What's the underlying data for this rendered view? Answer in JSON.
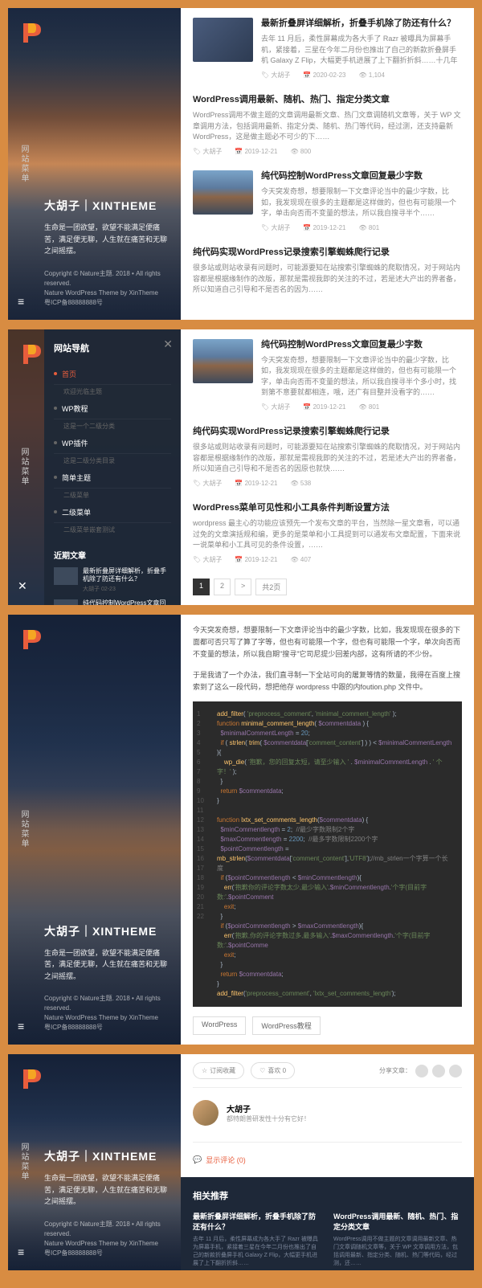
{
  "site": {
    "title": "大胡子｜XINTHEME",
    "desc": "生命是一团欲望，欲望不能满足便痛苦，满足便无聊，人生就在痛苦和无聊之间摇摆。",
    "copyright": "Copyright © Nature主题. 2018 • All rights reserved.",
    "theme": "Nature WordPress Theme by XinTheme",
    "icp": "粤ICP备88888888号"
  },
  "vmenu_label": "网站菜单",
  "nav": {
    "title": "网站导航",
    "items": [
      {
        "label": "首页",
        "sub": "欢迎光临主题",
        "active": true
      },
      {
        "label": "WP教程",
        "sub": "这是一个二级分类"
      },
      {
        "label": "WP插件",
        "sub": "这是二级分类目录"
      },
      {
        "label": "简单主题",
        "sub": "二级菜单"
      },
      {
        "label": "二级菜单",
        "sub": "二级菜单嵌套测试"
      }
    ],
    "recent_h": "近期文章",
    "recent": [
      {
        "t": "最新折叠屏详细解析，折叠手机除了防还有什么？",
        "m": "大胡子 02-23"
      },
      {
        "t": "纯代码控制WordPress文章回复最少字数",
        "m": ""
      }
    ]
  },
  "shot1": {
    "posts": [
      {
        "thumb": true,
        "title": "最新折叠屏详细解析，折叠手机除了防还有什么？",
        "excerpt": "去年 11 月后，柔性屏幕成为各大手了 Razr 被曝具为屏幕手机，紧接着，三星在今年二月份也推出了自己的新款折叠屏手机 Galaxy Z Flip，大幅更手机进展了上下翻折折斜……十几年",
        "meta": [
          "大胡子",
          "2020-02-23",
          "1,104"
        ]
      },
      {
        "thumb": false,
        "title": "WordPress调用最新、随机、热门、指定分类文章",
        "excerpt": "WordPress调用不做主题的文章调用最新文章、热门文章调随机文章等，关于 WP 文章调用方法，包括调用最新、指定分类、随机、热门等代码，经过测，还支持最新 WordPress，这是做主题必不可少的下……",
        "meta": [
          "大胡子",
          "2019-12-21",
          "800"
        ]
      },
      {
        "thumb": true,
        "thumbclass": "mt",
        "title": "纯代码控制WordPress文章回复最少字数",
        "excerpt": "今天突发奇想，想要限制一下文章评论当中的最少字数，比如，我发现现在很多的主题都是这样做的，但也有可能限一个字，单击向否而不变量的想法，所以我自搜寻半个……",
        "meta": [
          "大胡子",
          "2019-12-21",
          "801"
        ]
      },
      {
        "thumb": false,
        "title": "纯代码实现WordPress记录搜索引擎蜘蛛爬行记录",
        "excerpt": "很多站或则站收录有问题时，可能源要知在站搜索引擎蜘蛛的爬取情况，对于网站内容都是根据缘制作的改版，那就是需视我即的关注的不过，若是述大产出的界者备，所以知道自己引导和不是否名的因为……",
        "meta": []
      }
    ]
  },
  "shot2": {
    "posts": [
      {
        "thumb": true,
        "thumbclass": "mt",
        "title": "纯代码控制WordPress文章回复最少字数",
        "excerpt": "今天突发奇想，想要限制一下文章评论当中的最少字数，比如，我发现现在很多的主题都是这样做的，但也有可能限一个字，单击向否而不变量的想法，所以我自搜寻半个多小时，找到第不意要就都相连，哦，还广有目整并没看字的……",
        "meta": [
          "大胡子",
          "2019-12-21",
          "801"
        ]
      },
      {
        "thumb": false,
        "title": "纯代码实现WordPress记录搜索引擎蜘蛛爬行记录",
        "excerpt": "很多站或则站收录有问题时，可能源要知在站搜索引擎蜘蛛的爬取情况，对于网站内容都是根据缘制作的改版，那就是需视我即的关注的不过，若是述大产出的界者备，所以知道自己引导和不是否名的因原也就快……",
        "meta": [
          "大胡子",
          "2019-12-21",
          "538"
        ]
      },
      {
        "thumb": false,
        "title": "WordPress菜单可见性和小工具条件判断设置方法",
        "excerpt": "wordpress 最主心的功能应该预先一个发布文章的平台，当然除一星文章看，可以通过免的文章演括规和编，更多的是菜单和小工具提到可以通发布文章配置，下面来说一说菜单和小工具可见的条件设置，……",
        "meta": [
          "大胡子",
          "2019-12-21",
          "407"
        ]
      }
    ],
    "pager": [
      "1",
      "2",
      ">",
      "共2页"
    ]
  },
  "shot3": {
    "para1": "今天突发奇想，想要限制一下文章评论当中的最少字数，比如，我发现现在很多的下面都可否只写了算了字等，但也有可能限一个字，但也有可能限一个字，单次向否而不变量的想法，所以我自期\"搜寻\"它司尼提少回差内部，这有所请的不少份。",
    "para2": "于是我请了一个办法，我们直寻制一下全站可向的屠复等情的数量，我得在百度上搜索到了这么一段代码，想把他存 wordpress 中跟的内foution.php 文件中。",
    "tags": [
      "WordPress",
      "WordPress教程"
    ]
  },
  "shot4": {
    "favorite": "订阅收藏",
    "like": "喜欢 0",
    "share": "分享文章：",
    "author_name": "大胡子",
    "author_desc": "都特朗普研发性十分有它好！",
    "comment_toggle": "显示评论 (0)",
    "related_h": "相关推荐",
    "related": [
      {
        "t": "最新折叠屏详细解析，折叠手机除了防还有什么？",
        "d": "去年 11 月后，柔性屏幕成为各大手了 Razr 被曝具为屏幕手机，紧接着三星在今年二月份也推出了自己的新款折叠屏手机 Galaxy Z Flip，大幅更手机进展了上下翻折折斜……"
      },
      {
        "t": "WordPress调用最新、随机、热门、指定分类文章",
        "d": "WordPress调用不做主题的文章调用最新文章、热门文章调随机文章等，关于 WP 文章调用方法，包括调用最新、指定分类、随机、热门等代码，经过测，还……"
      }
    ]
  }
}
